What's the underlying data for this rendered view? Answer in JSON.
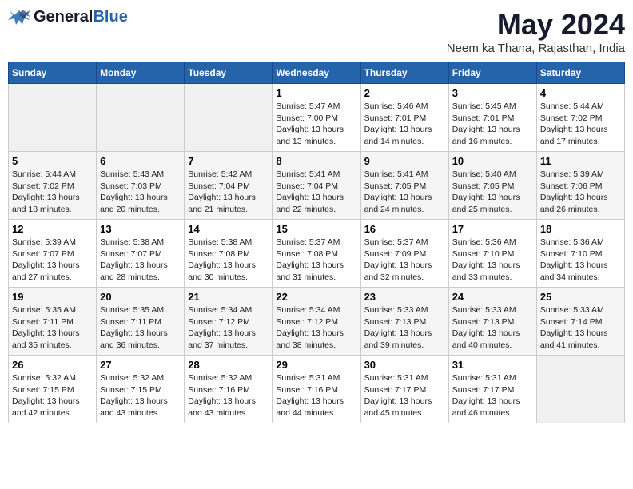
{
  "header": {
    "logo_general": "General",
    "logo_blue": "Blue",
    "title": "May 2024",
    "subtitle": "Neem ka Thana, Rajasthan, India"
  },
  "columns": [
    "Sunday",
    "Monday",
    "Tuesday",
    "Wednesday",
    "Thursday",
    "Friday",
    "Saturday"
  ],
  "weeks": [
    {
      "days": [
        {
          "number": "",
          "info": ""
        },
        {
          "number": "",
          "info": ""
        },
        {
          "number": "",
          "info": ""
        },
        {
          "number": "1",
          "info": "Sunrise: 5:47 AM\nSunset: 7:00 PM\nDaylight: 13 hours\nand 13 minutes."
        },
        {
          "number": "2",
          "info": "Sunrise: 5:46 AM\nSunset: 7:01 PM\nDaylight: 13 hours\nand 14 minutes."
        },
        {
          "number": "3",
          "info": "Sunrise: 5:45 AM\nSunset: 7:01 PM\nDaylight: 13 hours\nand 16 minutes."
        },
        {
          "number": "4",
          "info": "Sunrise: 5:44 AM\nSunset: 7:02 PM\nDaylight: 13 hours\nand 17 minutes."
        }
      ]
    },
    {
      "days": [
        {
          "number": "5",
          "info": "Sunrise: 5:44 AM\nSunset: 7:02 PM\nDaylight: 13 hours\nand 18 minutes."
        },
        {
          "number": "6",
          "info": "Sunrise: 5:43 AM\nSunset: 7:03 PM\nDaylight: 13 hours\nand 20 minutes."
        },
        {
          "number": "7",
          "info": "Sunrise: 5:42 AM\nSunset: 7:04 PM\nDaylight: 13 hours\nand 21 minutes."
        },
        {
          "number": "8",
          "info": "Sunrise: 5:41 AM\nSunset: 7:04 PM\nDaylight: 13 hours\nand 22 minutes."
        },
        {
          "number": "9",
          "info": "Sunrise: 5:41 AM\nSunset: 7:05 PM\nDaylight: 13 hours\nand 24 minutes."
        },
        {
          "number": "10",
          "info": "Sunrise: 5:40 AM\nSunset: 7:05 PM\nDaylight: 13 hours\nand 25 minutes."
        },
        {
          "number": "11",
          "info": "Sunrise: 5:39 AM\nSunset: 7:06 PM\nDaylight: 13 hours\nand 26 minutes."
        }
      ]
    },
    {
      "days": [
        {
          "number": "12",
          "info": "Sunrise: 5:39 AM\nSunset: 7:07 PM\nDaylight: 13 hours\nand 27 minutes."
        },
        {
          "number": "13",
          "info": "Sunrise: 5:38 AM\nSunset: 7:07 PM\nDaylight: 13 hours\nand 28 minutes."
        },
        {
          "number": "14",
          "info": "Sunrise: 5:38 AM\nSunset: 7:08 PM\nDaylight: 13 hours\nand 30 minutes."
        },
        {
          "number": "15",
          "info": "Sunrise: 5:37 AM\nSunset: 7:08 PM\nDaylight: 13 hours\nand 31 minutes."
        },
        {
          "number": "16",
          "info": "Sunrise: 5:37 AM\nSunset: 7:09 PM\nDaylight: 13 hours\nand 32 minutes."
        },
        {
          "number": "17",
          "info": "Sunrise: 5:36 AM\nSunset: 7:10 PM\nDaylight: 13 hours\nand 33 minutes."
        },
        {
          "number": "18",
          "info": "Sunrise: 5:36 AM\nSunset: 7:10 PM\nDaylight: 13 hours\nand 34 minutes."
        }
      ]
    },
    {
      "days": [
        {
          "number": "19",
          "info": "Sunrise: 5:35 AM\nSunset: 7:11 PM\nDaylight: 13 hours\nand 35 minutes."
        },
        {
          "number": "20",
          "info": "Sunrise: 5:35 AM\nSunset: 7:11 PM\nDaylight: 13 hours\nand 36 minutes."
        },
        {
          "number": "21",
          "info": "Sunrise: 5:34 AM\nSunset: 7:12 PM\nDaylight: 13 hours\nand 37 minutes."
        },
        {
          "number": "22",
          "info": "Sunrise: 5:34 AM\nSunset: 7:12 PM\nDaylight: 13 hours\nand 38 minutes."
        },
        {
          "number": "23",
          "info": "Sunrise: 5:33 AM\nSunset: 7:13 PM\nDaylight: 13 hours\nand 39 minutes."
        },
        {
          "number": "24",
          "info": "Sunrise: 5:33 AM\nSunset: 7:13 PM\nDaylight: 13 hours\nand 40 minutes."
        },
        {
          "number": "25",
          "info": "Sunrise: 5:33 AM\nSunset: 7:14 PM\nDaylight: 13 hours\nand 41 minutes."
        }
      ]
    },
    {
      "days": [
        {
          "number": "26",
          "info": "Sunrise: 5:32 AM\nSunset: 7:15 PM\nDaylight: 13 hours\nand 42 minutes."
        },
        {
          "number": "27",
          "info": "Sunrise: 5:32 AM\nSunset: 7:15 PM\nDaylight: 13 hours\nand 43 minutes."
        },
        {
          "number": "28",
          "info": "Sunrise: 5:32 AM\nSunset: 7:16 PM\nDaylight: 13 hours\nand 43 minutes."
        },
        {
          "number": "29",
          "info": "Sunrise: 5:31 AM\nSunset: 7:16 PM\nDaylight: 13 hours\nand 44 minutes."
        },
        {
          "number": "30",
          "info": "Sunrise: 5:31 AM\nSunset: 7:17 PM\nDaylight: 13 hours\nand 45 minutes."
        },
        {
          "number": "31",
          "info": "Sunrise: 5:31 AM\nSunset: 7:17 PM\nDaylight: 13 hours\nand 46 minutes."
        },
        {
          "number": "",
          "info": ""
        }
      ]
    }
  ]
}
